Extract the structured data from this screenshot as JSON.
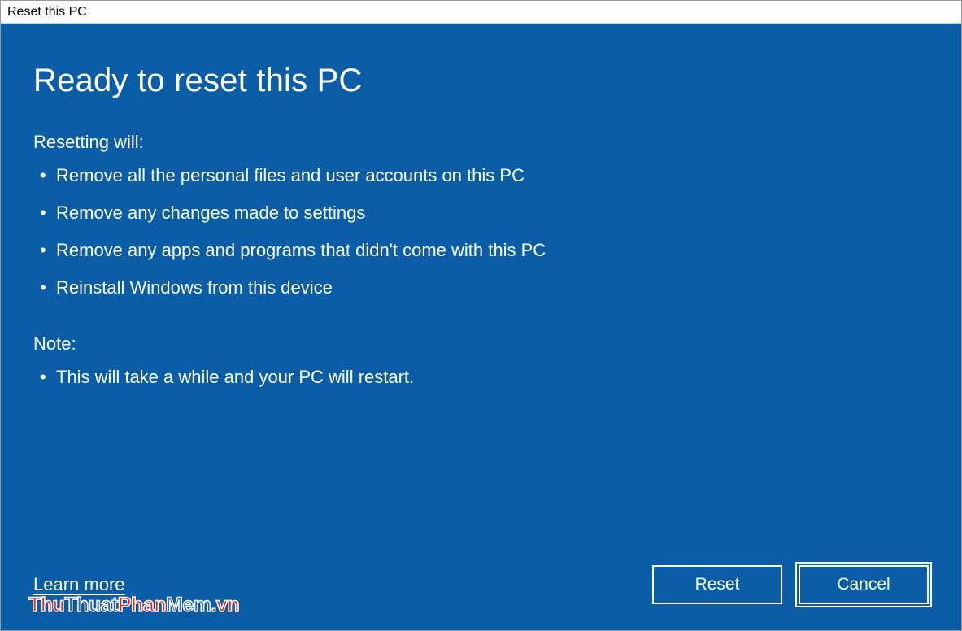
{
  "window": {
    "title": "Reset this PC"
  },
  "main": {
    "heading": "Ready to reset this PC",
    "section1_label": "Resetting will:",
    "bullets1": [
      "Remove all the personal files and user accounts on this PC",
      "Remove any changes made to settings",
      "Remove any apps and programs that didn't come with this PC",
      "Reinstall Windows from this device"
    ],
    "section2_label": "Note:",
    "bullets2": [
      "This will take a while and your PC will restart."
    ]
  },
  "footer": {
    "learn_more": "Learn more",
    "reset_label": "Reset",
    "cancel_label": "Cancel"
  },
  "watermark": {
    "p1": "Thu",
    "p2": "Thuat",
    "p3": "Phan",
    "p4": "Mem",
    "p5": ".vn"
  },
  "colors": {
    "background": "#0A5DA6",
    "text": "#FFFFFF"
  }
}
